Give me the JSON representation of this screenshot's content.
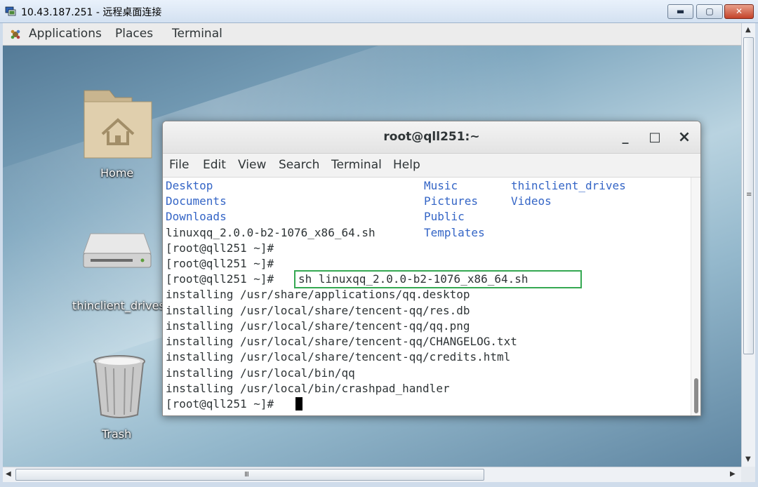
{
  "rdp": {
    "title": "10.43.187.251 - 远程桌面连接",
    "min_symbol": "▬",
    "max_symbol": "▢",
    "close_symbol": "✕",
    "hscroll_grip": "III",
    "vscroll_grip": "≡",
    "arrow_up": "▲",
    "arrow_down": "▼",
    "arrow_left": "◀",
    "arrow_right": "▶"
  },
  "topbar": {
    "applications": "Applications",
    "places": "Places",
    "terminal": "Terminal"
  },
  "desktop_icons": [
    {
      "label": "Home",
      "icon": "home-folder-icon"
    },
    {
      "label": "thinclient_drives",
      "icon": "drive-icon"
    },
    {
      "label": "Trash",
      "icon": "trash-icon"
    }
  ],
  "terminal": {
    "title": "root@qll251:~",
    "minimize": "_",
    "maximize": "□",
    "close": "×",
    "menu": [
      "File",
      "Edit",
      "View",
      "Search",
      "Terminal",
      "Help"
    ],
    "ls_col1": [
      "Desktop",
      "Documents",
      "Downloads",
      "linuxqq_2.0.0-b2-1076_x86_64.sh"
    ],
    "ls_col2": [
      "Music",
      "Pictures",
      "Public",
      "Templates"
    ],
    "ls_col3": [
      "thinclient_drives",
      "Videos"
    ],
    "prompt": "[root@qll251 ~]#",
    "command": "sh linuxqq_2.0.0-b2-1076_x86_64.sh",
    "output": [
      "installing /usr/share/applications/qq.desktop",
      "installing /usr/local/share/tencent-qq/res.db",
      "installing /usr/local/share/tencent-qq/qq.png",
      "installing /usr/local/share/tencent-qq/CHANGELOG.txt",
      "installing /usr/local/share/tencent-qq/credits.html",
      "installing /usr/local/bin/qq",
      "installing /usr/local/bin/crashpad_handler"
    ]
  },
  "colors": {
    "directory_blue": "#3465c6",
    "highlight_green": "#35a852"
  }
}
